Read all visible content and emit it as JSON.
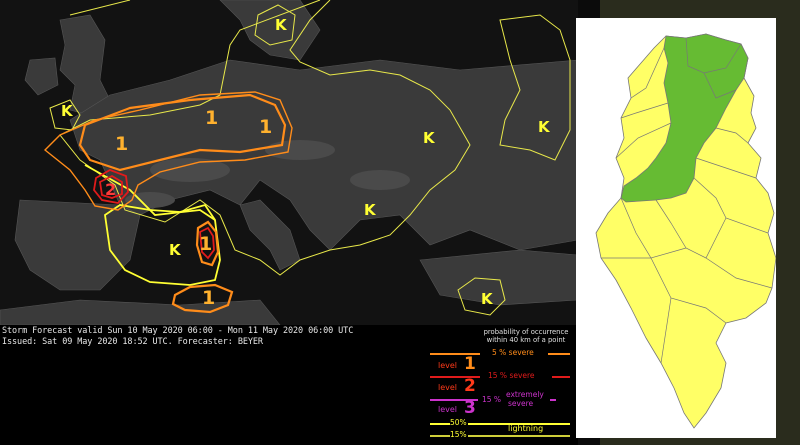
{
  "forecast": {
    "valid_line": "Storm Forecast valid Sun 10 May 2020 06:00 - Mon 11 May 2020 06:00 UTC",
    "issued_line": "Issued: Sat 09 May 2020 18:52 UTC. Forecaster: BEYER"
  },
  "map_labels": {
    "lightning_marks": [
      "K",
      "K",
      "K",
      "K",
      "K",
      "K",
      "K"
    ],
    "level_marks": [
      "1",
      "1",
      "1",
      "2",
      "1",
      "1"
    ]
  },
  "legend": {
    "header_1": "probability of occurrence",
    "header_2": "within 40 km of a point",
    "prob_5": "5 % severe",
    "level_word": "level",
    "level1_num": "1",
    "prob_15": "15 % severe",
    "level2_num": "2",
    "level3_num": "3",
    "prob_15_ext_a": "15 %",
    "prob_15_ext_b": "extremely",
    "prob_15_ext_c": "severe",
    "lightning_50": "50%",
    "lightning_15": "15%",
    "lightning_word": "lightning"
  },
  "colors": {
    "level1": "#ff8c1a",
    "level2": "#e01b1b",
    "level3": "#cc33cc",
    "lightning": "#ffff33",
    "tunisia_green": "#66bb33",
    "tunisia_yellow": "#ffff66"
  }
}
